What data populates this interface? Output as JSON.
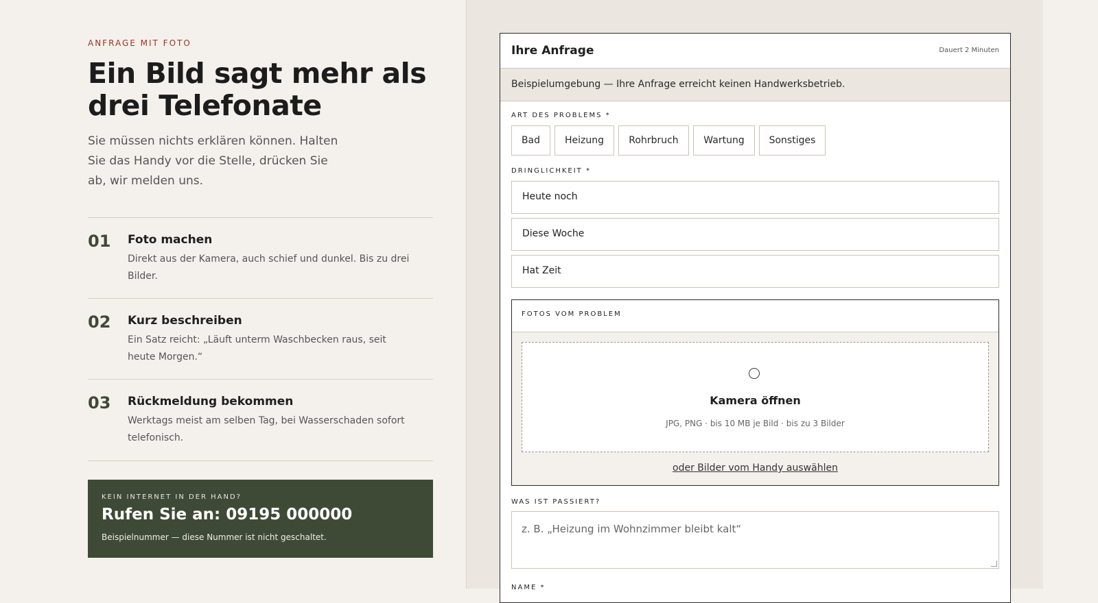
{
  "intro": {
    "eyebrow": "ANFRAGE MIT FOTO",
    "headline": "Ein Bild sagt mehr als drei Telefonate",
    "lead": "Sie müssen nichts erklären können. Halten Sie das Handy vor die Stelle, drücken Sie ab, wir melden uns."
  },
  "steps": [
    {
      "num": "01",
      "title": "Foto machen",
      "desc": "Direkt aus der Kamera, auch schief und dunkel. Bis zu drei Bilder."
    },
    {
      "num": "02",
      "title": "Kurz beschreiben",
      "desc": "Ein Satz reicht: „Läuft unterm Waschbecken raus, seit heute Morgen.“"
    },
    {
      "num": "03",
      "title": "Rückmeldung bekommen",
      "desc": "Werktags meist am selben Tag, bei Wasserschaden sofort telefonisch."
    }
  ],
  "call": {
    "eyebrow": "KEIN INTERNET IN DER HAND?",
    "title": "Rufen Sie an: 09195 000000",
    "note": "Beispielnummer — diese Nummer ist nicht geschaltet."
  },
  "form": {
    "title": "Ihre Anfrage",
    "duration": "Dauert 2 Minuten",
    "demo_note": "Beispielumgebung — Ihre Anfrage erreicht keinen Handwerksbetrieb.",
    "problem_label": "ART DES PROBLEMS *",
    "problem_types": [
      "Bad",
      "Heizung",
      "Rohrbruch",
      "Wartung",
      "Sonstiges"
    ],
    "urgency_label": "DRINGLICHKEIT *",
    "urgency_options": [
      "Heute noch",
      "Diese Woche",
      "Hat Zeit"
    ],
    "photos_label": "FOTOS VOM PROBLEM",
    "camera_title": "Kamera öffnen",
    "camera_hint": "JPG, PNG · bis 10 MB je Bild · bis zu 3 Bilder",
    "alt_link": "oder Bilder vom Handy auswählen",
    "what_label": "WAS IST PASSIERT?",
    "what_placeholder": "z. B. „Heizung im Wohnzimmer bleibt kalt“",
    "name_label": "NAME *"
  }
}
